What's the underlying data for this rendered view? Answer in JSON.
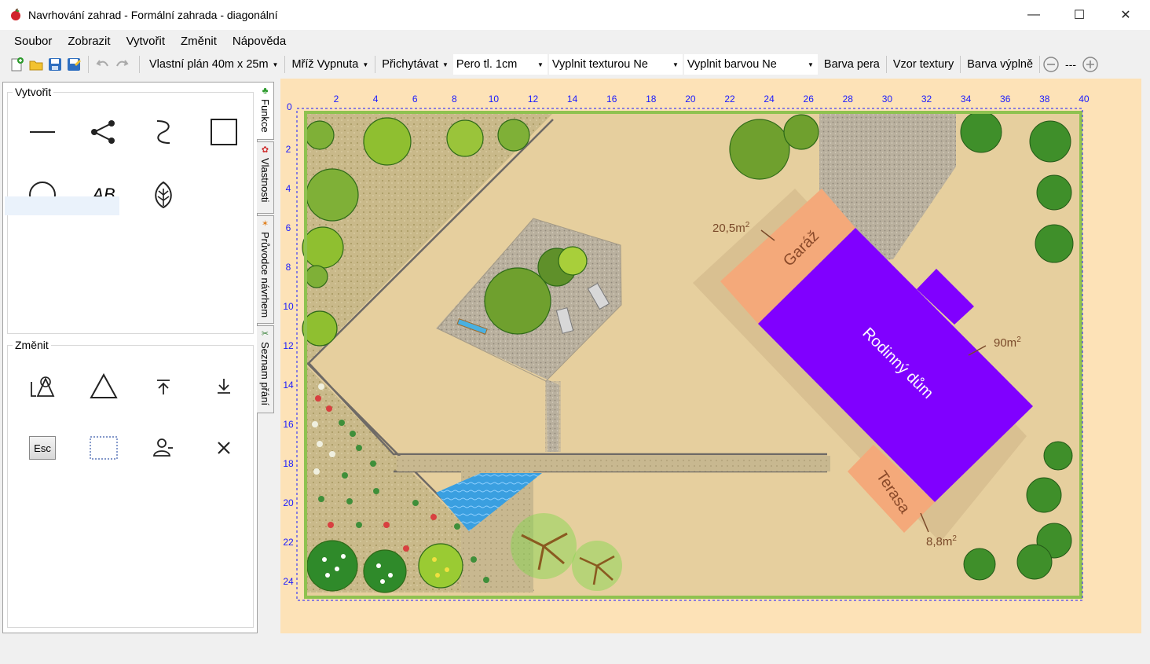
{
  "window": {
    "title": "Navrhování zahrad - Formální zahrada - diagonální",
    "minimize_glyph": "—",
    "maximize_glyph": "☐",
    "close_glyph": "✕"
  },
  "menu": [
    "Soubor",
    "Zobrazit",
    "Vytvořit",
    "Změnit",
    "Nápověda"
  ],
  "toolbar": {
    "plan": "Vlastní plán 40m x 25m",
    "grid": "Mříž Vypnuta",
    "snap": "Přichytávat",
    "pen": "Pero tl. 1cm",
    "fill_texture": "Vyplnit texturou Ne",
    "fill_color": "Vyplnit barvou Ne",
    "pen_color": "Barva pera",
    "texture_pattern": "Vzor textury",
    "fill_color_btn": "Barva výplně",
    "zoom_value": "---",
    "icons": [
      "new-file-icon",
      "open-folder-icon",
      "save-icon",
      "save-as-icon",
      "undo-icon",
      "redo-icon",
      "zoom-out-icon",
      "zoom-in-icon"
    ]
  },
  "panel": {
    "create_group": "Vytvořit",
    "modify_group": "Změnit",
    "create_tools": [
      "line-tool-icon",
      "polyline-tool-icon",
      "curve-tool-icon",
      "rectangle-tool-icon",
      "circle-tool-icon",
      "text-tool-icon",
      "plant-tool-icon"
    ],
    "text_tool_label": "AB",
    "modify_tools": [
      "edit-shape-icon",
      "triangle-icon",
      "bring-to-front-icon",
      "send-to-back-icon",
      "escape-key-icon",
      "selection-rect-icon",
      "person-icon",
      "delete-icon"
    ],
    "esc_label": "Esc"
  },
  "side_tabs": [
    "Funkce",
    "Vlastnosti",
    "Průvodce návrhem",
    "Seznam přání"
  ],
  "plan": {
    "x_ticks": [
      "0",
      "2",
      "4",
      "6",
      "8",
      "10",
      "12",
      "14",
      "16",
      "18",
      "20",
      "22",
      "24",
      "26",
      "28",
      "30",
      "32",
      "34",
      "36",
      "38",
      "40"
    ],
    "y_ticks": [
      "2",
      "4",
      "6",
      "8",
      "10",
      "12",
      "14",
      "16",
      "18",
      "20",
      "22",
      "24"
    ],
    "labels": {
      "garage": "Garáž",
      "garage_area": "20,5m",
      "house": "Rodinný dům",
      "house_area": "90m",
      "terrace": "Terasa",
      "terrace_area": "8,8m",
      "sq": "2"
    },
    "colors": {
      "house": "#8000ff",
      "garage": "#f4a97a",
      "lawn": "#e8cf9d",
      "gravel": "#b5ac98",
      "water": "#3aa0e0",
      "ruler": "#1a1aff"
    }
  }
}
